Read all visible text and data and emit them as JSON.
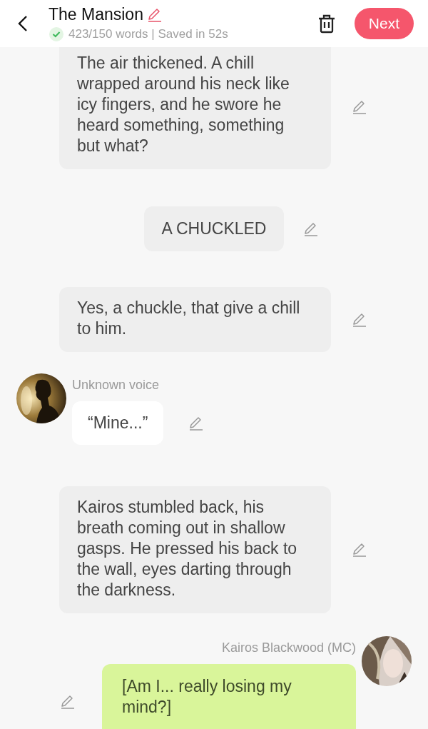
{
  "header": {
    "title": "The Mansion",
    "status": "423/150 words | Saved in 52s",
    "next_button": "Next"
  },
  "messages": [
    {
      "kind": "narration",
      "text": "The air thickened. A chill wrapped around his neck like icy fingers, and he swore he heard something, something but what?"
    },
    {
      "kind": "center",
      "text": "A CHUCKLED"
    },
    {
      "kind": "narration",
      "text": "Yes, a chuckle, that give a chill to him."
    },
    {
      "kind": "character-left",
      "speaker": "Unknown voice",
      "text": "“Mine...”"
    },
    {
      "kind": "narration",
      "text": "Kairos stumbled back, his breath coming out in shallow gasps. He pressed his back to the wall, eyes darting through the darkness."
    },
    {
      "kind": "character-right",
      "speaker": "Kairos Blackwood (MC)",
      "text": "[Am I... really losing my mind?]"
    }
  ]
}
